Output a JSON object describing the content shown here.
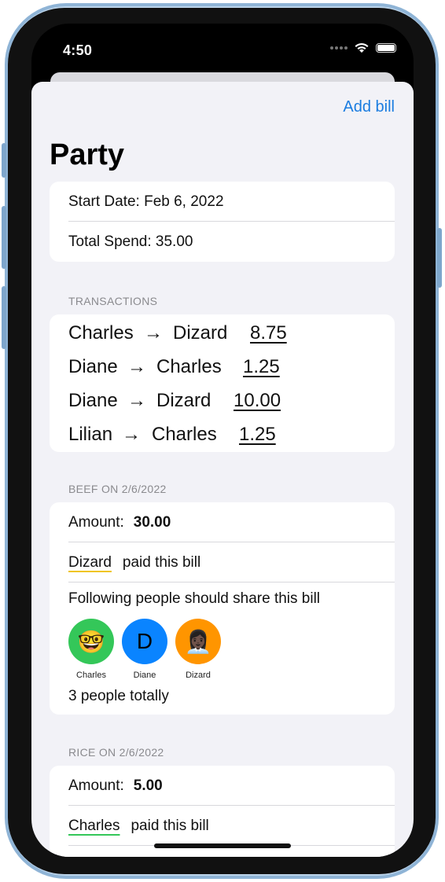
{
  "status": {
    "time": "4:50"
  },
  "nav": {
    "add_bill_label": "Add bill"
  },
  "page_title": "Party",
  "summary": {
    "start_date": "Start Date: Feb 6, 2022",
    "total_spend": "Total Spend: 35.00"
  },
  "transactions_header": "TRANSACTIONS",
  "transactions": [
    {
      "from": "Charles",
      "to": "Dizard",
      "amount": "8.75"
    },
    {
      "from": "Diane",
      "to": "Charles",
      "amount": "1.25"
    },
    {
      "from": "Diane",
      "to": "Dizard",
      "amount": "10.00"
    },
    {
      "from": "Lilian",
      "to": "Charles",
      "amount": "1.25"
    }
  ],
  "arrow_glyph": "→",
  "bills": [
    {
      "header": "BEEF ON 2/6/2022",
      "amount_label": "Amount:",
      "amount": "30.00",
      "payer": "Dizard",
      "payer_color": "#f0c419",
      "paid_text": "paid this bill",
      "share_text": "Following people should share this bill",
      "sharers": [
        {
          "name": "Charles",
          "glyph": "🤓",
          "color": "#34c759"
        },
        {
          "name": "Diane",
          "glyph": "D",
          "color": "#0a84ff"
        },
        {
          "name": "Dizard",
          "glyph": "👩🏿‍💼",
          "color": "#ff9500"
        }
      ],
      "total_text": "3 people totally"
    },
    {
      "header": "RICE ON 2/6/2022",
      "amount_label": "Amount:",
      "amount": "5.00",
      "payer": "Charles",
      "payer_color": "#34c759",
      "paid_text": "paid this bill"
    }
  ]
}
